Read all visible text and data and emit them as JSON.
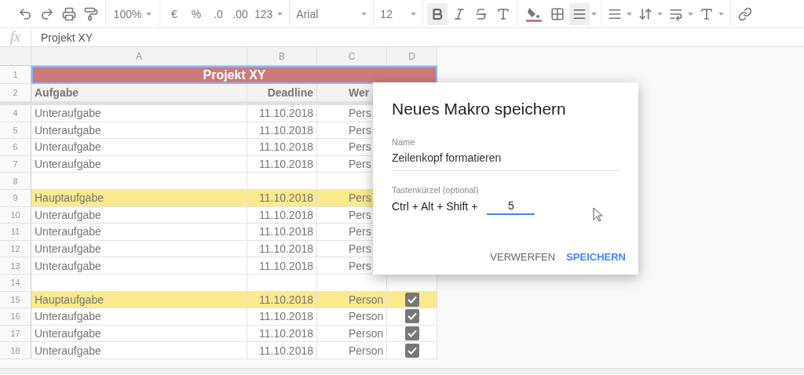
{
  "toolbar": {
    "zoom": "100%",
    "currency": "€",
    "percent": "%",
    "decrease_decimals": ".0",
    "increase_decimals": ".00",
    "number_format": "123",
    "font": "Arial",
    "font_size": "12",
    "bold_active": true,
    "merge_active": true
  },
  "formula_bar": {
    "label": "fx",
    "value": "Projekt XY"
  },
  "columns": [
    "A",
    "B",
    "C",
    "D"
  ],
  "rows": [
    {
      "number": "1",
      "kind": "title",
      "cells": [
        "Projekt XY"
      ]
    },
    {
      "number": "2",
      "kind": "header",
      "cells": [
        "Aufgabe",
        "Deadline",
        "Wer"
      ]
    },
    {
      "number": "4",
      "kind": "sub",
      "cells": [
        "Unteraufgabe",
        "11.10.2018",
        "Pers"
      ]
    },
    {
      "number": "5",
      "kind": "sub",
      "cells": [
        "Unteraufgabe",
        "11.10.2018",
        "Pers"
      ]
    },
    {
      "number": "6",
      "kind": "sub",
      "cells": [
        "Unteraufgabe",
        "11.10.2018",
        "Pers"
      ]
    },
    {
      "number": "7",
      "kind": "sub",
      "cells": [
        "Unteraufgabe",
        "11.10.2018",
        "Pers"
      ]
    },
    {
      "number": "8",
      "kind": "empty",
      "cells": []
    },
    {
      "number": "9",
      "kind": "main",
      "cells": [
        "Hauptaufgabe",
        "11.10.2018",
        "Pers"
      ]
    },
    {
      "number": "10",
      "kind": "sub",
      "cells": [
        "Unteraufgabe",
        "11.10.2018",
        "Pers"
      ]
    },
    {
      "number": "11",
      "kind": "sub",
      "cells": [
        "Unteraufgabe",
        "11.10.2018",
        "Pers"
      ]
    },
    {
      "number": "12",
      "kind": "sub",
      "cells": [
        "Unteraufgabe",
        "11.10.2018",
        "Pers"
      ]
    },
    {
      "number": "13",
      "kind": "sub",
      "cells": [
        "Unteraufgabe",
        "11.10.2018",
        "Pers"
      ]
    },
    {
      "number": "14",
      "kind": "empty",
      "cells": []
    },
    {
      "number": "15",
      "kind": "main",
      "cells": [
        "Hauptaufgabe",
        "11.10.2018",
        "Person"
      ],
      "checked": true
    },
    {
      "number": "16",
      "kind": "sub",
      "cells": [
        "Unteraufgabe",
        "11.10.2018",
        "Person"
      ],
      "checked": true
    },
    {
      "number": "17",
      "kind": "sub",
      "cells": [
        "Unteraufgabe",
        "11.10.2018",
        "Person"
      ],
      "checked": true
    },
    {
      "number": "18",
      "kind": "sub",
      "cells": [
        "Unteraufgabe",
        "11.10.2018",
        "Person"
      ],
      "checked": true
    }
  ],
  "dialog": {
    "title": "Neues Makro speichern",
    "name_label": "Name",
    "name_value": "Zeilenkopf formatieren",
    "shortcut_label": "Tastenkürzel (optional)",
    "shortcut_prefix": "Ctrl + Alt + Shift +",
    "shortcut_value": "5",
    "buttons": [
      {
        "label": "VERWERFEN",
        "primary": false
      },
      {
        "label": "SPEICHERN",
        "primary": true
      }
    ]
  }
}
